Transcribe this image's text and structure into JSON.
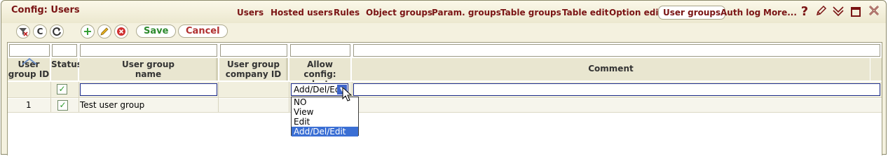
{
  "window": {
    "title": "Config: Users"
  },
  "nav": {
    "items": [
      {
        "label": "Users",
        "active": false
      },
      {
        "label": "Hosted users",
        "active": false
      },
      {
        "label": "Rules",
        "active": false
      },
      {
        "label": "Object groups",
        "active": false
      },
      {
        "label": "Param. groups",
        "active": false
      },
      {
        "label": "Table groups",
        "active": false
      },
      {
        "label": "Table edit",
        "active": false
      },
      {
        "label": "Option edit",
        "active": false
      },
      {
        "label": "User groups",
        "active": true
      },
      {
        "label": "Auth log",
        "active": false
      },
      {
        "label": "More...",
        "active": false
      }
    ]
  },
  "window_icons": [
    "help-icon",
    "pencil-icon",
    "chevron-down-icon",
    "maximize-icon",
    "close-icon"
  ],
  "toolbar": {
    "icons": [
      "clear-filter-icon",
      "reset-icon",
      "refresh-icon",
      "add-icon",
      "edit-icon",
      "delete-icon"
    ],
    "save_label": "Save",
    "cancel_label": "Cancel"
  },
  "grid": {
    "columns": [
      {
        "label": "User group ID",
        "lines": [
          "User",
          "group ID"
        ]
      },
      {
        "label": "Status",
        "lines": [
          "Status"
        ]
      },
      {
        "label": "User group name",
        "lines": [
          "User group",
          "name"
        ]
      },
      {
        "label": "User group company ID",
        "lines": [
          "User group",
          "company ID"
        ]
      },
      {
        "label": "Allow config: alerts",
        "lines": [
          "Allow config:",
          "alerts"
        ]
      },
      {
        "label": "Comment",
        "lines": [
          "Comment"
        ]
      }
    ],
    "edit_row": {
      "status_checked": true,
      "name_value": "",
      "alerts_value": "Add/Del/Edit",
      "comment_value": ""
    },
    "rows": [
      {
        "id": "1",
        "status_checked": true,
        "name": "Test user group",
        "company_id": "",
        "alerts": "",
        "comment": ""
      }
    ],
    "alerts_options": [
      {
        "label": "NO",
        "selected": false
      },
      {
        "label": "View",
        "selected": false
      },
      {
        "label": "Edit",
        "selected": false
      },
      {
        "label": "Add/Del/Edit",
        "selected": true
      }
    ]
  },
  "colors": {
    "title_red": "#7a1414",
    "save_green": "#2d8a2d",
    "cancel_red": "#b03030",
    "selection_blue": "#3b6fd4"
  }
}
